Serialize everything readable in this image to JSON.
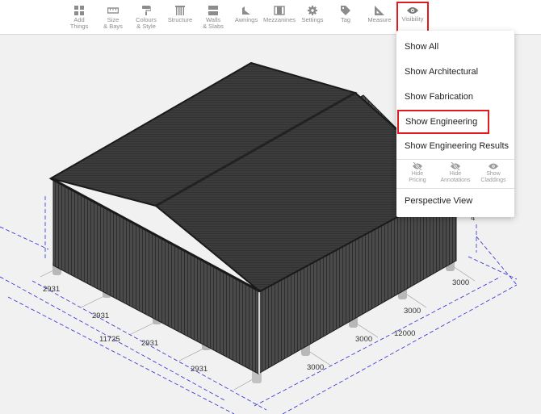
{
  "toolbar": {
    "items": [
      {
        "label": "Add\nThings",
        "icon": "add-things-icon"
      },
      {
        "label": "Size\n& Bays",
        "icon": "ruler-icon"
      },
      {
        "label": "Colours\n& Style",
        "icon": "paint-roller-icon"
      },
      {
        "label": "Structure",
        "icon": "structure-icon"
      },
      {
        "label": "Walls\n& Slabs",
        "icon": "walls-icon"
      },
      {
        "label": "Awnings",
        "icon": "awning-icon"
      },
      {
        "label": "Mezzanines",
        "icon": "mezzanine-icon"
      },
      {
        "label": "Settings",
        "icon": "gear-icon"
      },
      {
        "label": "Tag",
        "icon": "tag-icon"
      },
      {
        "label": "Measure",
        "icon": "set-square-icon"
      },
      {
        "label": "Visibility",
        "icon": "eye-icon"
      }
    ],
    "active_item": "Visibility"
  },
  "visibility_menu": {
    "items": [
      "Show All",
      "Show Architectural",
      "Show Fabrication",
      "Show Engineering",
      "Show Engineering Results"
    ],
    "highlighted": "Show Engineering",
    "toggles": [
      {
        "label": "Hide\nPricing",
        "icon": "eye-off-icon"
      },
      {
        "label": "Hide\nAnnotations",
        "icon": "eye-off-icon"
      },
      {
        "label": "Show\nCladdings",
        "icon": "eye-icon"
      }
    ],
    "perspective": "Perspective View"
  },
  "dimensions": {
    "left_bays": [
      "2931",
      "2931",
      "2931",
      "2931"
    ],
    "left_total": "11725",
    "right_bays": [
      "3000",
      "3000",
      "3000",
      "3000"
    ],
    "right_total": "12000",
    "partial_label": "4"
  },
  "colors": {
    "highlight": "#e21a1a",
    "roof": "#3b3b3b",
    "wall": "#4a4a4a",
    "dimension_line": "#2b2bd4"
  }
}
